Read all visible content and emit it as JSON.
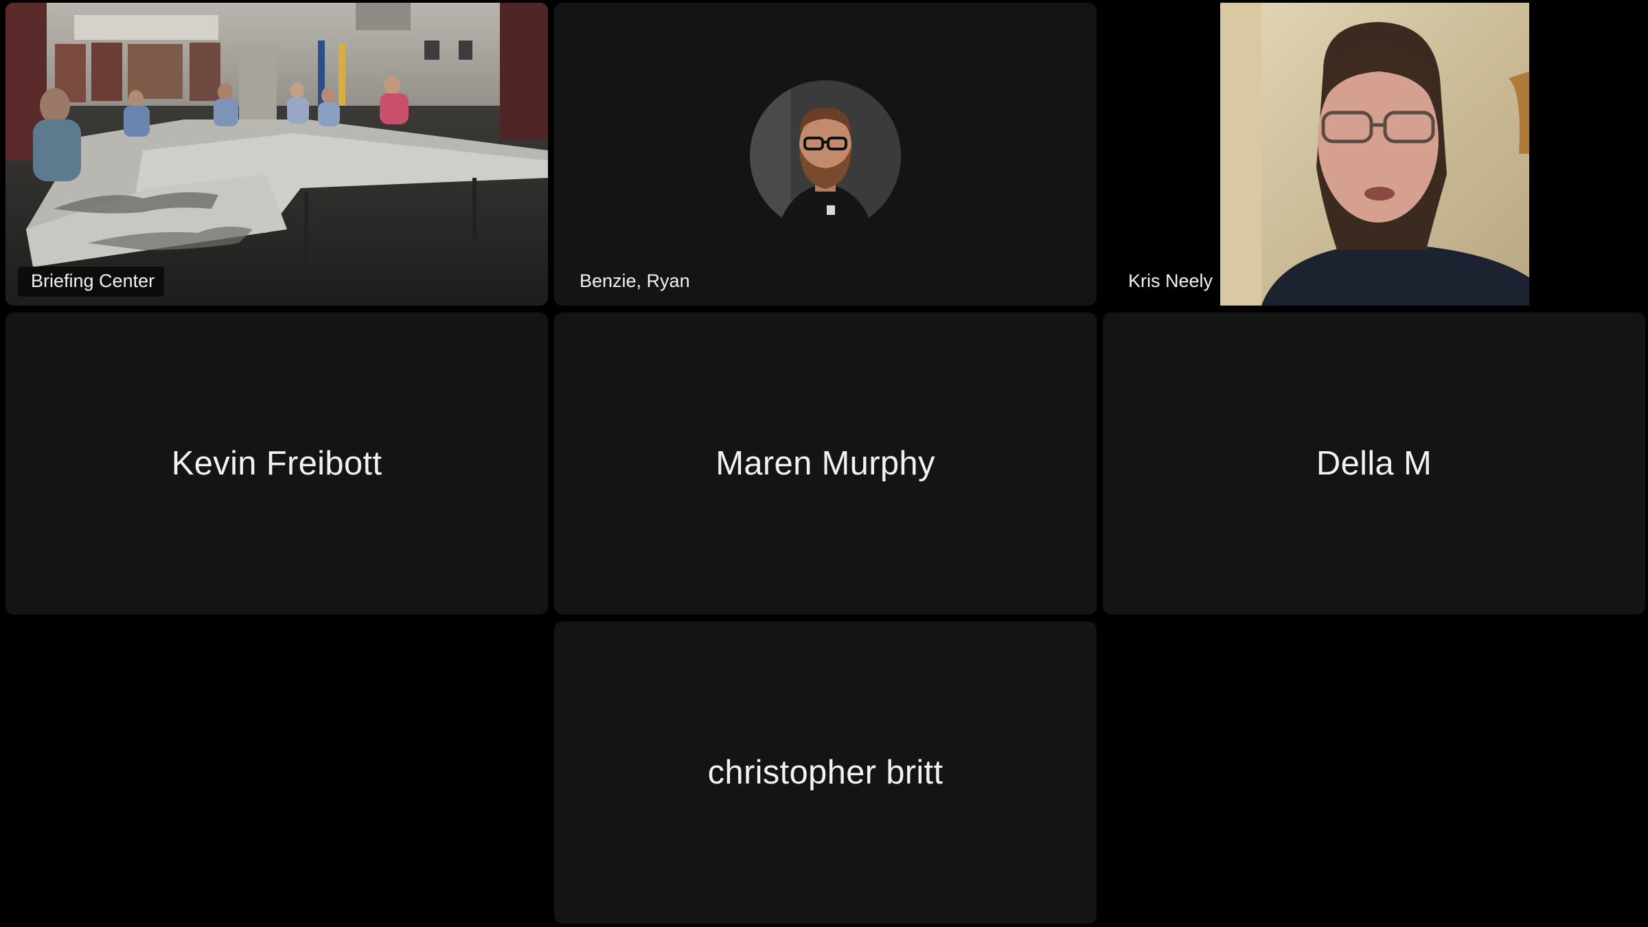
{
  "participants": [
    {
      "name": "Briefing Center",
      "video": "room-camera"
    },
    {
      "name": "Benzie, Ryan",
      "video": "avatar"
    },
    {
      "name": "Kris Neely",
      "video": "webcam"
    },
    {
      "name": "Kevin Freibott",
      "video": "none"
    },
    {
      "name": "Maren Murphy",
      "video": "none"
    },
    {
      "name": "Della M",
      "video": "none"
    },
    {
      "name": "christopher britt",
      "video": "none"
    }
  ],
  "colors": {
    "background": "#000000",
    "tile": "#141414",
    "text": "#f2f2f2"
  }
}
